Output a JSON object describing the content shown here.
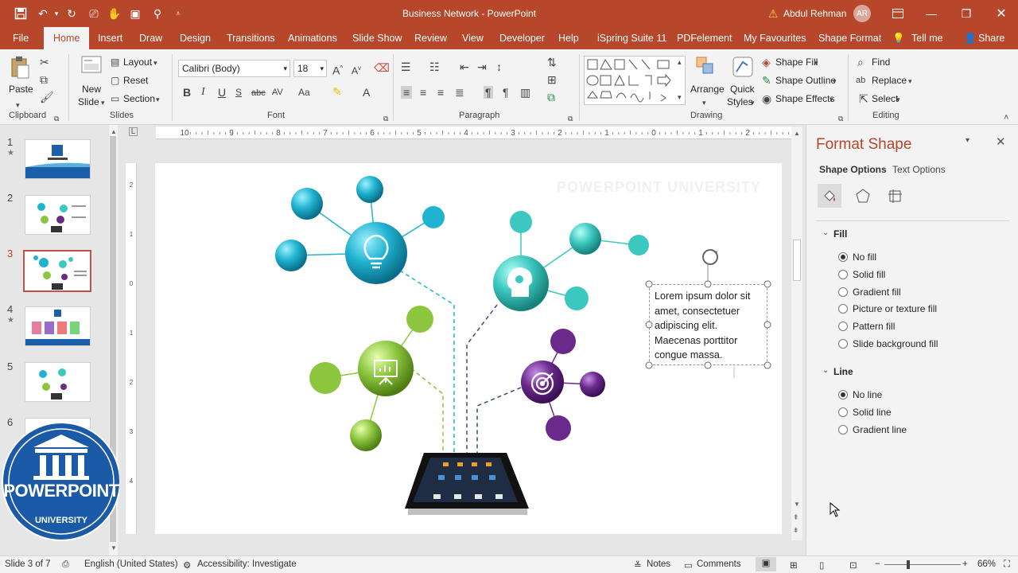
{
  "app": {
    "title": "Business Network  -  PowerPoint",
    "user_name": "Abdul Rehman",
    "user_initials": "AR",
    "accent": "#b7472a"
  },
  "tabs": [
    "File",
    "Home",
    "Insert",
    "Draw",
    "Design",
    "Transitions",
    "Animations",
    "Slide Show",
    "Review",
    "View",
    "Developer",
    "Help",
    "iSpring Suite 11",
    "PDFelement",
    "My Favourites",
    "Shape Format"
  ],
  "tell_me": "Tell me",
  "share": "Share",
  "ribbon": {
    "clipboard": {
      "paste": "Paste",
      "label": "Clipboard"
    },
    "slides": {
      "new_slide_1": "New",
      "new_slide_2": "Slide",
      "layout": "Layout",
      "reset": "Reset",
      "section": "Section",
      "label": "Slides"
    },
    "font": {
      "name": "Calibri (Body)",
      "size": "18",
      "label": "Font"
    },
    "paragraph": {
      "label": "Paragraph"
    },
    "drawing": {
      "arrange": "Arrange",
      "quick_styles_1": "Quick",
      "quick_styles_2": "Styles",
      "shape_fill": "Shape Fill",
      "shape_outline": "Shape Outline",
      "shape_effects": "Shape Effects",
      "label": "Drawing"
    },
    "editing": {
      "find": "Find",
      "replace": "Replace",
      "select": "Select",
      "label": "Editing"
    }
  },
  "slides_panel": {
    "numbers": [
      "1",
      "2",
      "3",
      "4",
      "5",
      "6"
    ],
    "selected": "3"
  },
  "slide": {
    "watermark": "POWERPOINT UNIVERSITY",
    "textbox": "Lorem ipsum dolor sit amet, consectetuer adipiscing elit. Maecenas porttitor congue massa.",
    "colors": {
      "cyan": "#1fb3d0",
      "teal": "#3cc8c0",
      "green": "#8cc63f",
      "purple": "#6a2a8c"
    }
  },
  "logo": {
    "line1": "POWERPOINT",
    "line2": "UNIVERSITY"
  },
  "format_pane": {
    "title": "Format Shape",
    "tab_shape": "Shape Options",
    "tab_text": "Text Options",
    "fill_header": "Fill",
    "fill_options": [
      "No fill",
      "Solid fill",
      "Gradient fill",
      "Picture or texture fill",
      "Pattern fill",
      "Slide background fill"
    ],
    "fill_selected": "No fill",
    "line_header": "Line",
    "line_options": [
      "No line",
      "Solid line",
      "Gradient line"
    ],
    "line_selected": "No line"
  },
  "status": {
    "slide_of": "Slide 3 of 7",
    "language": "English (United States)",
    "accessibility": "Accessibility: Investigate",
    "notes": "Notes",
    "comments": "Comments",
    "zoom": "66%"
  }
}
